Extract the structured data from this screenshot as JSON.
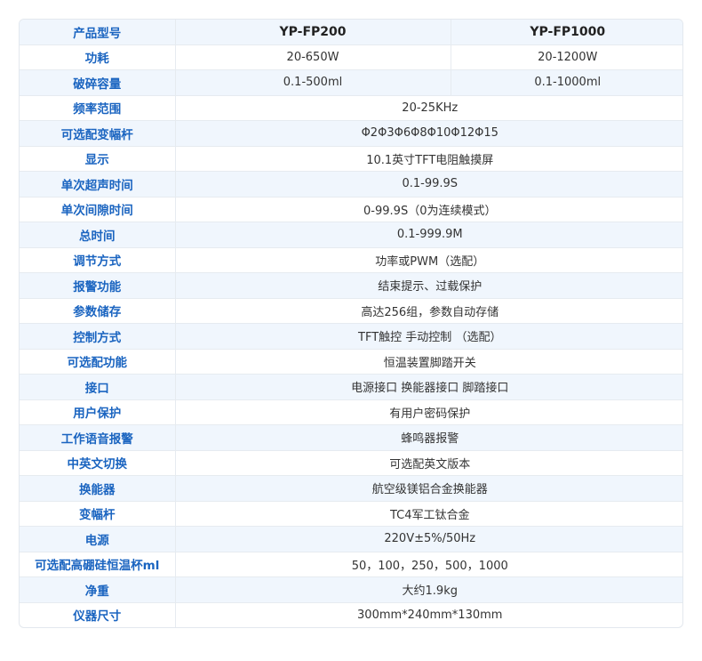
{
  "header": {
    "label": "产品型号",
    "models": [
      "YP-FP200",
      "YP-FP1000"
    ]
  },
  "split_rows": [
    {
      "label": "功耗",
      "values": [
        "20-650W",
        "20-1200W"
      ]
    },
    {
      "label": "破碎容量",
      "values": [
        "0.1-500ml",
        "0.1-1000ml"
      ]
    }
  ],
  "rows": [
    {
      "label": "频率范围",
      "value": "20-25KHz"
    },
    {
      "label": "可选配变幅杆",
      "value": "Φ2Φ3Φ6Φ8Φ10Φ12Φ15"
    },
    {
      "label": "显示",
      "value": "10.1英寸TFT电阻触摸屏"
    },
    {
      "label": "单次超声时间",
      "value": "0.1-99.9S"
    },
    {
      "label": "单次间隙时间",
      "value": "0-99.9S（0为连续模式）"
    },
    {
      "label": "总时间",
      "value": "0.1-999.9M"
    },
    {
      "label": "调节方式",
      "value": "功率或PWM（选配）"
    },
    {
      "label": "报警功能",
      "value": "结束提示、过载保护"
    },
    {
      "label": "参数储存",
      "value": "高达256组，参数自动存储"
    },
    {
      "label": "控制方式",
      "value": "TFT触控 手动控制 （选配）"
    },
    {
      "label": "可选配功能",
      "value": "恒温装置脚踏开关"
    },
    {
      "label": "接口",
      "value": "电源接口 换能器接口 脚踏接口"
    },
    {
      "label": "用户保护",
      "value": "有用户密码保护"
    },
    {
      "label": "工作语音报警",
      "value": "蜂鸣器报警"
    },
    {
      "label": "中英文切换",
      "value": "可选配英文版本"
    },
    {
      "label": "换能器",
      "value": "航空级镁铝合金换能器"
    },
    {
      "label": "变幅杆",
      "value": "TC4军工钛合金"
    },
    {
      "label": "电源",
      "value": "220V±5%/50Hz"
    },
    {
      "label": "可选配高硼硅恒温杯ml",
      "value": "50，100，250，500，1000"
    },
    {
      "label": "净重",
      "value": "大约1.9kg"
    },
    {
      "label": "仪器尺寸",
      "value": "300mm*240mm*130mm"
    }
  ],
  "colors": {
    "label_text": "#1a64c0",
    "alt_row_bg": "#f0f6fd",
    "border": "#e6ebf0"
  }
}
